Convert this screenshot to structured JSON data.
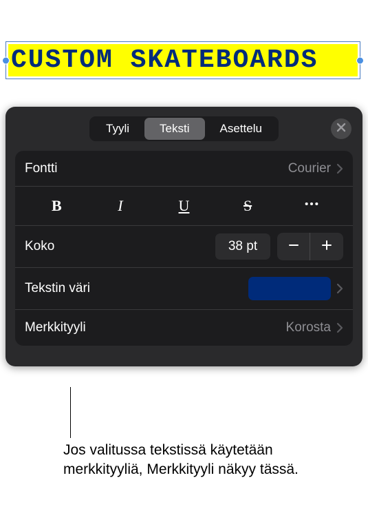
{
  "canvas": {
    "selected_text": "CUSTOM SKATEBOARDS"
  },
  "panel": {
    "tabs": {
      "style": "Tyyli",
      "text": "Teksti",
      "layout": "Asettelu"
    },
    "font": {
      "label": "Fontti",
      "value": "Courier"
    },
    "size": {
      "label": "Koko",
      "value": "38 pt"
    },
    "text_color": {
      "label": "Tekstin väri",
      "value_hex": "#002b7a"
    },
    "char_style": {
      "label": "Merkkityyli",
      "value": "Korosta"
    }
  },
  "callout": {
    "text": "Jos valitussa tekstissä käytetään merkkityyliä, Merkkityyli näkyy tässä."
  }
}
